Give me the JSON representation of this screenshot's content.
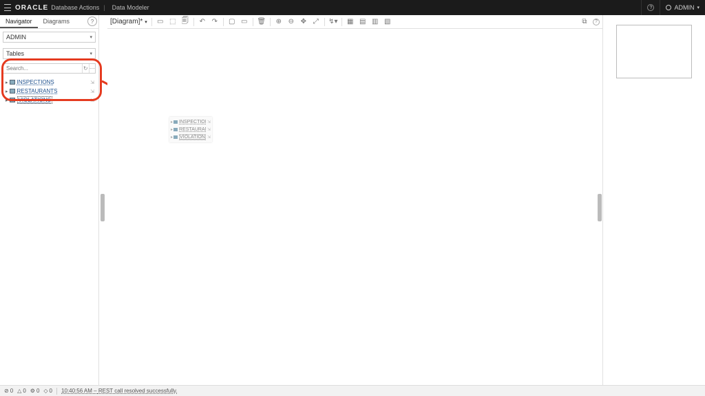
{
  "header": {
    "brand": "ORACLE",
    "app": "Database Actions",
    "section": "Data Modeler",
    "user": "ADMIN"
  },
  "sidebar": {
    "tabs": {
      "navigator": "Navigator",
      "diagrams": "Diagrams"
    },
    "schema_select": "ADMIN",
    "type_select": "Tables",
    "search_placeholder": "Search...",
    "tree": [
      {
        "label": "INSPECTIONS"
      },
      {
        "label": "RESTAURANTS"
      },
      {
        "label": "VIOLATIONS"
      }
    ]
  },
  "toolbar": {
    "doc_tab": "[Diagram]*"
  },
  "ghost": {
    "items": [
      {
        "label": "INSPECTIONS"
      },
      {
        "label": "RESTAURANTS"
      },
      {
        "label": "VIOLATIONS"
      }
    ]
  },
  "status": {
    "err": "0",
    "warn": "0",
    "info": "0",
    "run": "0",
    "time": "10:40:56 AM",
    "msg": "REST call resolved successfully."
  }
}
